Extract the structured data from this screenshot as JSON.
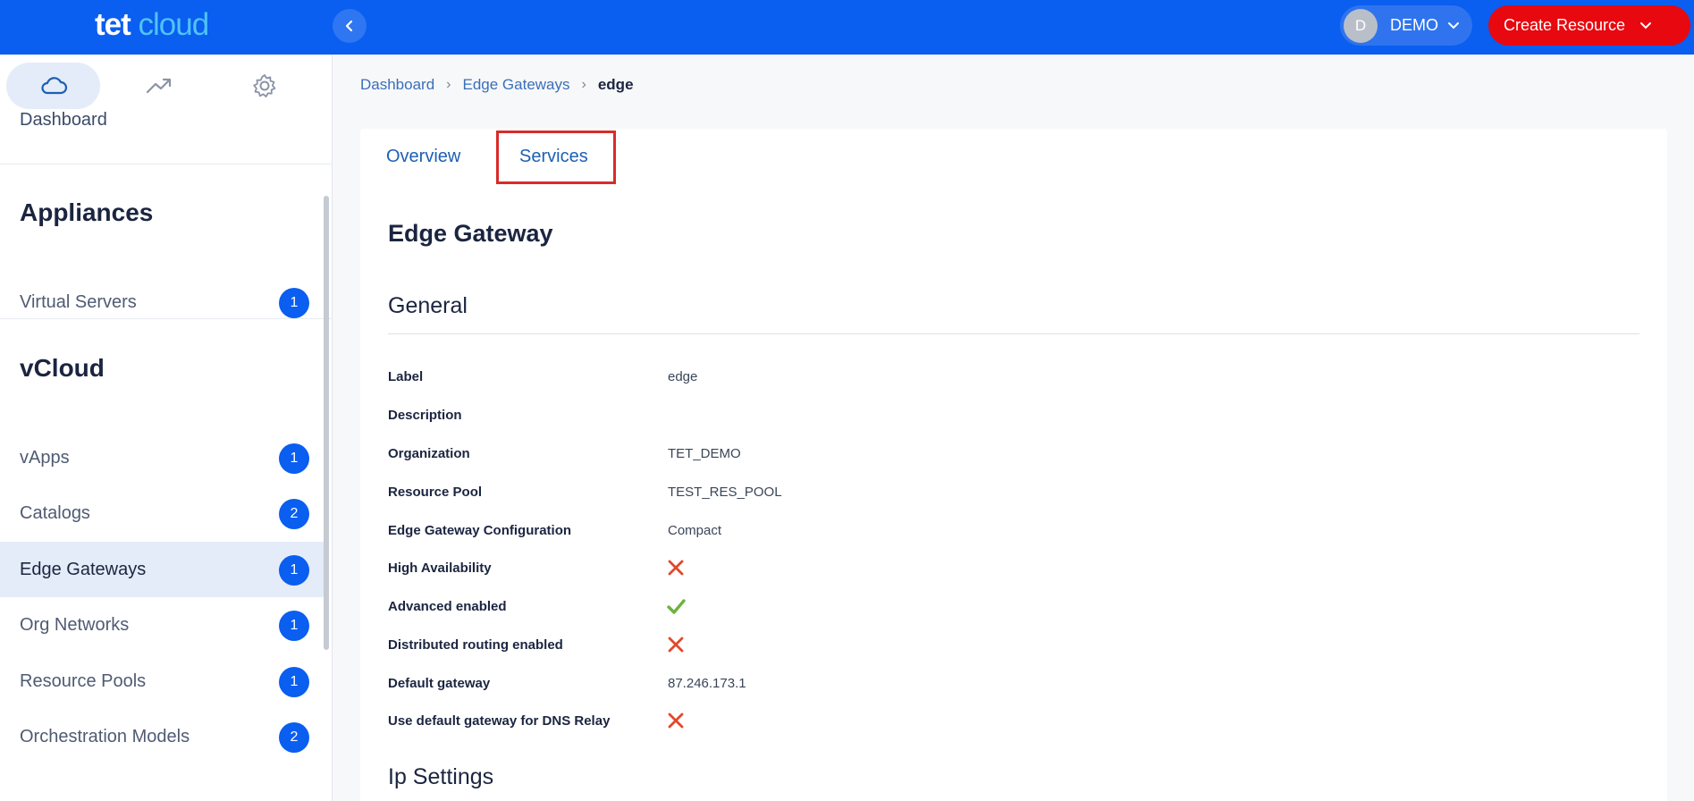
{
  "brand": {
    "logo_word1": "tet",
    "logo_word2": "cloud"
  },
  "header": {
    "user_initial": "D",
    "user_name": "DEMO",
    "create_label": "Create Resource"
  },
  "sidebar": {
    "tab_icons": [
      "cloud-icon",
      "trend-icon",
      "gear-icon"
    ],
    "dashboard_label": "Dashboard",
    "sections": [
      {
        "heading": "Appliances",
        "items": [
          {
            "label": "Virtual Servers",
            "count": "1"
          }
        ]
      },
      {
        "heading": "vCloud",
        "items": [
          {
            "label": "vApps",
            "count": "1"
          },
          {
            "label": "Catalogs",
            "count": "2"
          },
          {
            "label": "Edge Gateways",
            "count": "1",
            "active": true
          },
          {
            "label": "Org Networks",
            "count": "1"
          },
          {
            "label": "Resource Pools",
            "count": "1"
          },
          {
            "label": "Orchestration Models",
            "count": "2"
          }
        ]
      }
    ]
  },
  "breadcrumb": {
    "item1": "Dashboard",
    "item2": "Edge Gateways",
    "current": "edge"
  },
  "tabs": {
    "overview": "Overview",
    "services": "Services"
  },
  "main": {
    "title": "Edge Gateway",
    "section_general": "General",
    "section_ip": "Ip Settings",
    "rows": [
      {
        "label": "Label",
        "value": "edge"
      },
      {
        "label": "Description",
        "value": ""
      },
      {
        "label": "Organization",
        "value": "TET_DEMO"
      },
      {
        "label": "Resource Pool",
        "value": "TEST_RES_POOL"
      },
      {
        "label": "Edge Gateway Configuration",
        "value": "Compact"
      },
      {
        "label": "High Availability",
        "icon": "cross-icon"
      },
      {
        "label": "Advanced enabled",
        "icon": "check-icon"
      },
      {
        "label": "Distributed routing enabled",
        "icon": "cross-icon"
      },
      {
        "label": "Default gateway",
        "value": "87.246.173.1"
      },
      {
        "label": "Use default gateway for DNS Relay",
        "icon": "cross-icon"
      }
    ]
  },
  "colors": {
    "primary": "#0a5ef0",
    "danger": "#e8080f",
    "cross": "#e0482c",
    "check": "#6cb33e"
  }
}
